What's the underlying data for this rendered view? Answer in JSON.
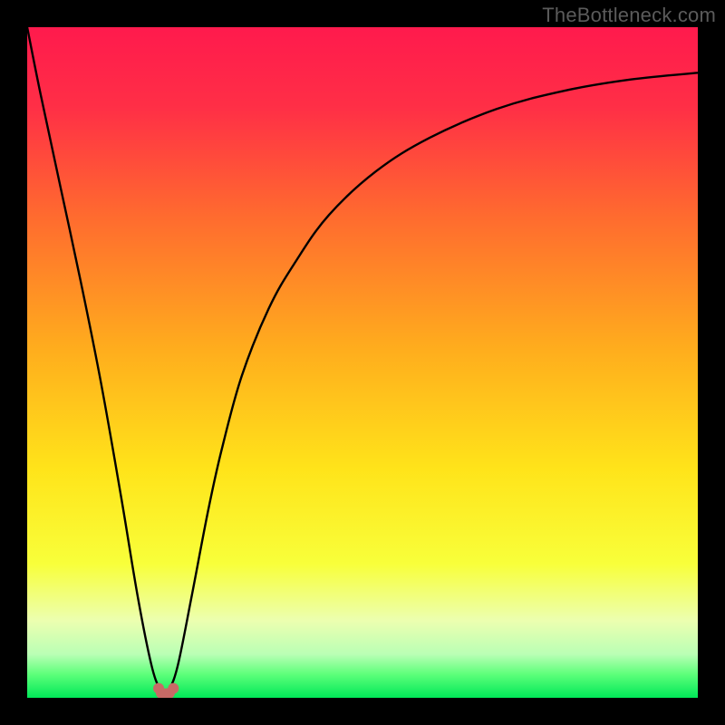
{
  "watermark": "TheBottleneck.com",
  "chart_data": {
    "type": "line",
    "title": "",
    "xlabel": "",
    "ylabel": "",
    "xlim": [
      0,
      100
    ],
    "ylim": [
      0,
      100
    ],
    "gradient_stops": [
      {
        "pos": 0.0,
        "color": "#ff1a4d"
      },
      {
        "pos": 0.12,
        "color": "#ff2f46"
      },
      {
        "pos": 0.28,
        "color": "#ff6a2f"
      },
      {
        "pos": 0.48,
        "color": "#ffad1d"
      },
      {
        "pos": 0.66,
        "color": "#ffe41a"
      },
      {
        "pos": 0.8,
        "color": "#f8ff3a"
      },
      {
        "pos": 0.885,
        "color": "#ecffb0"
      },
      {
        "pos": 0.935,
        "color": "#baffb5"
      },
      {
        "pos": 0.965,
        "color": "#5dff7a"
      },
      {
        "pos": 1.0,
        "color": "#00e858"
      }
    ],
    "series": [
      {
        "name": "bottleneck-curve",
        "x": [
          0,
          2,
          5,
          8,
          11,
          14,
          16.5,
          18.5,
          19.8,
          20.5,
          21.2,
          22.5,
          24.5,
          27,
          29,
          32,
          36,
          40,
          45,
          52,
          60,
          70,
          80,
          90,
          100
        ],
        "y": [
          100,
          90,
          76,
          62,
          47,
          30,
          15,
          5,
          1.2,
          0.6,
          1.2,
          5,
          15,
          28,
          37,
          48,
          58,
          65,
          72,
          78.5,
          83.5,
          87.8,
          90.5,
          92.2,
          93.2
        ]
      }
    ],
    "markers": {
      "name": "bottom-knot",
      "color": "#c76a66",
      "points": [
        {
          "x": 19.6,
          "y": 1.4
        },
        {
          "x": 20.0,
          "y": 0.7
        },
        {
          "x": 20.6,
          "y": 0.6
        },
        {
          "x": 21.2,
          "y": 0.7
        },
        {
          "x": 21.8,
          "y": 1.4
        }
      ],
      "radius": 6
    },
    "grid": false,
    "legend": false
  }
}
